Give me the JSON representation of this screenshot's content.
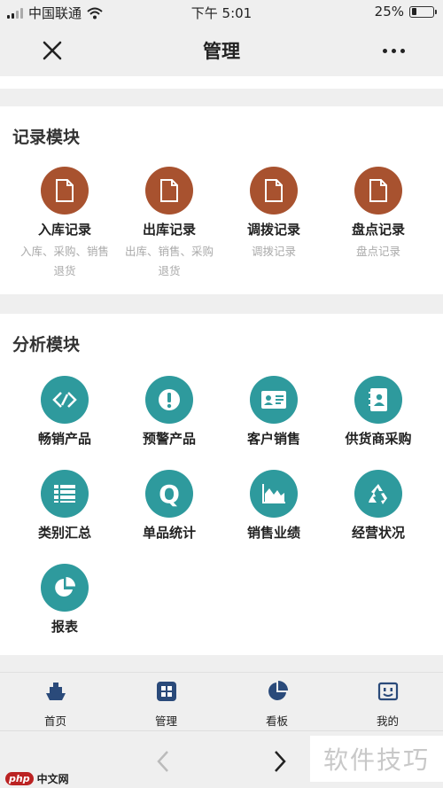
{
  "status_bar": {
    "carrier": "中国联通",
    "time": "下午 5:01",
    "battery": "25%",
    "battery_level": 0.25
  },
  "header": {
    "title": "管理",
    "close_icon": "close-icon",
    "more_icon": "more-icon"
  },
  "record_module": {
    "title": "记录模块",
    "items": [
      {
        "label": "入库记录",
        "desc1": "入库、采购、销售",
        "desc2": "退货",
        "icon": "document-icon"
      },
      {
        "label": "出库记录",
        "desc1": "出库、销售、采购",
        "desc2": "退货",
        "icon": "document-icon"
      },
      {
        "label": "调拨记录",
        "desc1": "调拨记录",
        "desc2": "",
        "icon": "document-icon"
      },
      {
        "label": "盘点记录",
        "desc1": "盘点记录",
        "desc2": "",
        "icon": "document-icon"
      }
    ]
  },
  "analysis_module": {
    "title": "分析模块",
    "items": [
      {
        "label": "畅销产品",
        "icon": "tag-icon"
      },
      {
        "label": "预警产品",
        "icon": "alert-icon"
      },
      {
        "label": "客户销售",
        "icon": "id-card-icon"
      },
      {
        "label": "供货商采购",
        "icon": "contact-book-icon"
      },
      {
        "label": "类别汇总",
        "icon": "list-icon"
      },
      {
        "label": "单品统计",
        "icon": "q-icon"
      },
      {
        "label": "销售业绩",
        "icon": "area-chart-icon"
      },
      {
        "label": "经营状况",
        "icon": "recycle-icon"
      },
      {
        "label": "报表",
        "icon": "pie-chart-icon"
      }
    ]
  },
  "tab_bar": {
    "tabs": [
      {
        "label": "首页",
        "icon": "ship-icon"
      },
      {
        "label": "管理",
        "icon": "grid-icon"
      },
      {
        "label": "看板",
        "icon": "pie-icon"
      },
      {
        "label": "我的",
        "icon": "robot-face-icon"
      }
    ]
  },
  "browser_bar": {
    "back_icon": "chevron-left-icon",
    "forward_icon": "chevron-right-icon"
  },
  "watermark": {
    "text": "软件技巧"
  },
  "logo": {
    "badge": "php",
    "text": "中文网"
  },
  "colors": {
    "record_icon_bg": "#a8522f",
    "analysis_icon_bg": "#2e9a9d",
    "page_bg": "#efefef"
  }
}
